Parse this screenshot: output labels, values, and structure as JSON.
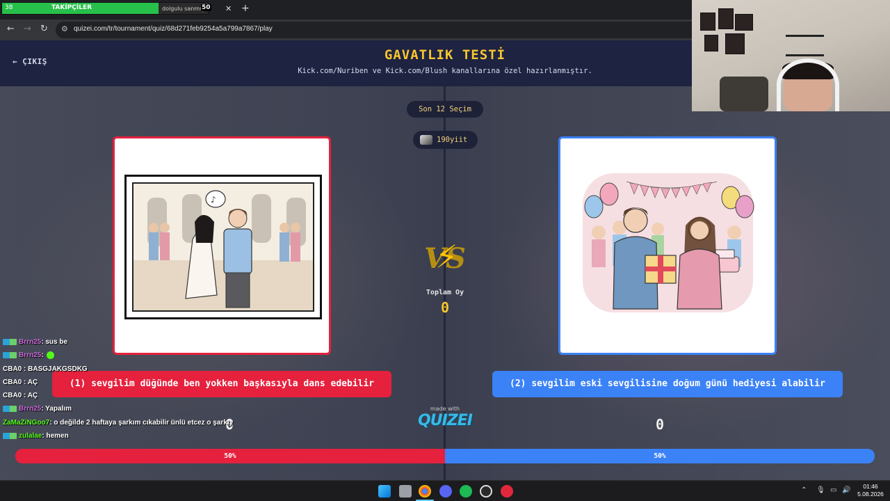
{
  "browser": {
    "follower_overlay": {
      "count": "38",
      "label": "TAKİPÇİLER",
      "tab_text": "dolgulu sanmışı çekme",
      "goal": "50",
      "progress": 0.76
    },
    "url": "quizei.com/tr/tournament/quiz/68d271feb9254a5a799a7867/play"
  },
  "header": {
    "exit_label": "ÇIKIŞ",
    "title": "GAVATLIK TESTİ",
    "subtitle": "Kick.com/Nuriben ve Kick.com/Blush kanallarına özel hazırlanmıştır."
  },
  "match": {
    "round_label": "Son 12 Seçim",
    "user_label": "190yiit",
    "total_votes_label": "Toplam Oy",
    "total_votes": "0",
    "made_with": "made with",
    "brand": "QUIZEI",
    "options": [
      {
        "label": "(1) sevgilim düğünde ben yokken başkasıyla dans edebilir",
        "votes": "0",
        "percent_label": "50%",
        "percent": 50,
        "color": "#e5213d"
      },
      {
        "label": "(2) sevgilim eski sevgilisine doğum günü hediyesi alabilir",
        "votes": "0",
        "percent_label": "50%",
        "percent": 50,
        "color": "#3b82f6"
      }
    ]
  },
  "chat": [
    {
      "user": "Brrn25",
      "message": ": sus be",
      "user_color": "pink",
      "badge": true
    },
    {
      "user": "Brrn25",
      "message": ":",
      "user_color": "pink",
      "badge": true,
      "emote": true
    },
    {
      "user": "CBA0",
      "message": " : BASGJAKGSDKG",
      "user_color": "white",
      "badge": false
    },
    {
      "user": "CBA0",
      "message": " : AÇ",
      "user_color": "white",
      "badge": false
    },
    {
      "user": "CBA0",
      "message": " : AÇ",
      "user_color": "white",
      "badge": false
    },
    {
      "user": "Brrn25",
      "message": ": Yapalım",
      "user_color": "pink",
      "badge": true
    },
    {
      "user": "ZaMaZiNGoo7",
      "message": ": o değilde 2 haftaya şarkım cıkabilir ünlü etcez o şarkıy",
      "user_color": "green",
      "badge": false
    },
    {
      "user": "zulalae",
      "message": ": hemen",
      "user_color": "green",
      "badge": true
    }
  ],
  "taskbar": {
    "time": "01:46",
    "date": "5.08.2026"
  }
}
